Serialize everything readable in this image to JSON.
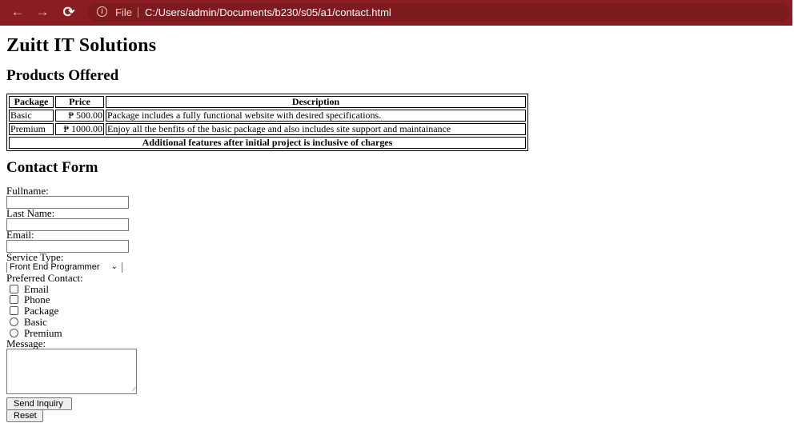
{
  "browser": {
    "back_icon": "arrow-left",
    "forward_icon": "arrow-right",
    "reload_icon": "reload",
    "info_icon": "info",
    "scheme_label": "File",
    "url": "C:/Users/admin/Documents/b230/s05/a1/contact.html",
    "colors": {
      "toolbar": "#8b1c21",
      "omnibox": "#7d1a1e"
    }
  },
  "page": {
    "title": "Zuitt IT Solutions",
    "products_heading": "Products Offered",
    "table": {
      "headers": [
        "Package",
        "Price",
        "Description"
      ],
      "rows": [
        [
          "Basic",
          "₱ 500.00",
          "Package includes a fully functional website with desired specifications."
        ],
        [
          "Premium",
          "₱ 1000.00",
          "Enjoy all the benfits of the basic package and also includes site support and maintainance"
        ]
      ],
      "footer": "Additional features after initial project is inclusive of charges"
    },
    "contact_heading": "Contact Form",
    "form": {
      "fullname_label": "Fullname:",
      "fullname_value": "",
      "lastname_label": "Last Name:",
      "lastname_value": "",
      "email_label": "Email:",
      "email_value": "",
      "service_label": "Service Type:",
      "service_selected": "Front End Programmer",
      "preferred_label": "Preferred Contact:",
      "checkboxes": [
        {
          "label": "Email",
          "checked": false
        },
        {
          "label": "Phone",
          "checked": false
        },
        {
          "label": "Package",
          "checked": false
        }
      ],
      "radios": [
        {
          "label": "Basic",
          "checked": false
        },
        {
          "label": "Premium",
          "checked": false
        }
      ],
      "message_label": "Message:",
      "message_value": "",
      "send_button": "Send Inquiry",
      "reset_button": "Reset"
    }
  }
}
